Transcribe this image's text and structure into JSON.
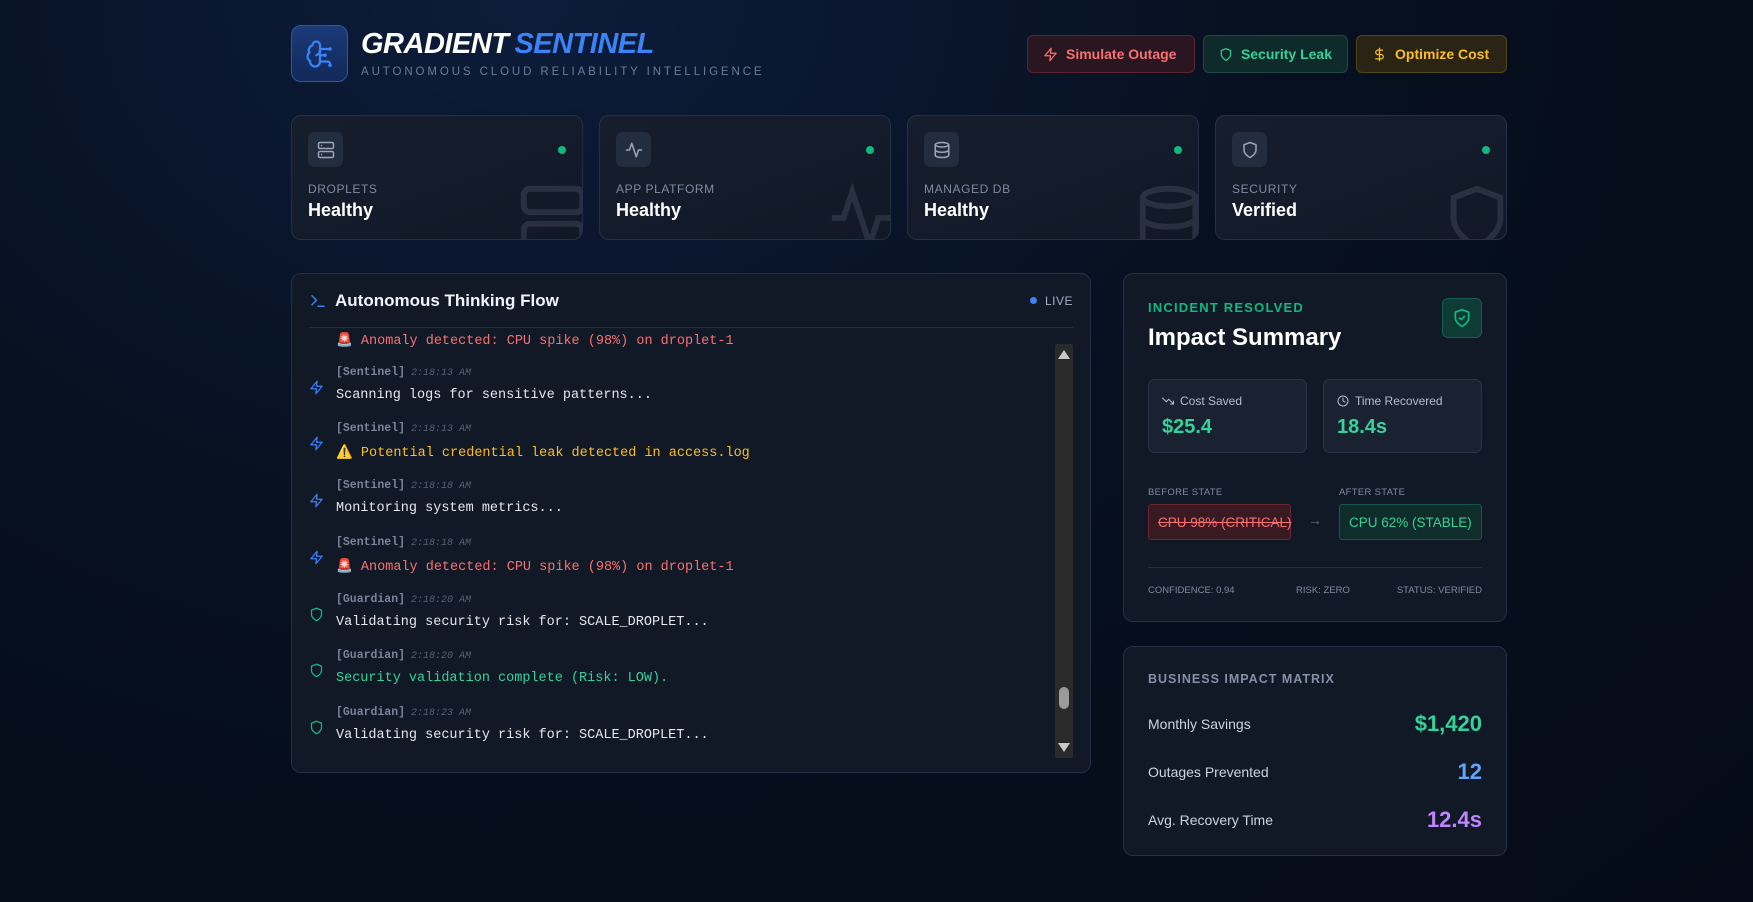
{
  "header": {
    "brand_word1": "GRADIENT",
    "brand_word2": "SENTINEL",
    "subtitle": "AUTONOMOUS CLOUD RELIABILITY INTELLIGENCE",
    "actions": [
      {
        "label": "Simulate Outage",
        "icon": "zap-icon",
        "color": "#f87171"
      },
      {
        "label": "Security Leak",
        "icon": "shield-icon",
        "color": "#34d399"
      },
      {
        "label": "Optimize Cost",
        "icon": "dollar-icon",
        "color": "#fbbf24"
      }
    ]
  },
  "status_cards": [
    {
      "label": "DROPLETS",
      "value": "Healthy",
      "icon": "server-icon",
      "status_color": "#10b981"
    },
    {
      "label": "APP PLATFORM",
      "value": "Healthy",
      "icon": "activity-icon",
      "status_color": "#10b981"
    },
    {
      "label": "MANAGED DB",
      "value": "Healthy",
      "icon": "database-icon",
      "status_color": "#10b981"
    },
    {
      "label": "SECURITY",
      "value": "Verified",
      "icon": "shield-icon",
      "status_color": "#10b981"
    }
  ],
  "flow": {
    "title": "Autonomous Thinking Flow",
    "live_label": "LIVE",
    "partial_top_message": "🚨 Anomaly detected: CPU spike (98%) on droplet-1",
    "entries": [
      {
        "agent": "[Sentinel]",
        "time": "2:18:13 AM",
        "message": "Scanning logs for sensitive patterns...",
        "tone": "white",
        "icon": "zap-icon"
      },
      {
        "agent": "[Sentinel]",
        "time": "2:18:13 AM",
        "message": "⚠️ Potential credential leak detected in access.log",
        "tone": "yellow",
        "icon": "zap-icon"
      },
      {
        "agent": "[Sentinel]",
        "time": "2:18:18 AM",
        "message": "Monitoring system metrics...",
        "tone": "white",
        "icon": "zap-icon"
      },
      {
        "agent": "[Sentinel]",
        "time": "2:18:18 AM",
        "message": "🚨 Anomaly detected: CPU spike (98%) on droplet-1",
        "tone": "red",
        "icon": "zap-icon"
      },
      {
        "agent": "[Guardian]",
        "time": "2:18:20 AM",
        "message": "Validating security risk for: SCALE_DROPLET...",
        "tone": "white",
        "icon": "shield-icon"
      },
      {
        "agent": "[Guardian]",
        "time": "2:18:20 AM",
        "message": "Security validation complete (Risk: LOW).",
        "tone": "green",
        "icon": "shield-icon"
      },
      {
        "agent": "[Guardian]",
        "time": "2:18:23 AM",
        "message": "Validating security risk for: SCALE_DROPLET...",
        "tone": "white",
        "icon": "shield-icon"
      }
    ]
  },
  "impact": {
    "tag": "INCIDENT RESOLVED",
    "title": "Impact Summary",
    "cost_saved_label": "Cost Saved",
    "cost_saved_value": "$25.4",
    "time_recovered_label": "Time Recovered",
    "time_recovered_value": "18.4s",
    "before_label": "BEFORE STATE",
    "before_value": "CPU 98% (CRITICAL)",
    "after_label": "AFTER STATE",
    "after_value": "CPU 62% (STABLE)",
    "confidence": "CONFIDENCE: 0.94",
    "risk": "RISK: ZERO",
    "status": "STATUS: VERIFIED"
  },
  "business": {
    "title": "BUSINESS IMPACT MATRIX",
    "rows": [
      {
        "label": "Monthly Savings",
        "value": "$1,420",
        "color": "#34d399"
      },
      {
        "label": "Outages Prevented",
        "value": "12",
        "color": "#60a5fa"
      },
      {
        "label": "Avg. Recovery Time",
        "value": "12.4s",
        "color": "#c084fc"
      }
    ]
  }
}
